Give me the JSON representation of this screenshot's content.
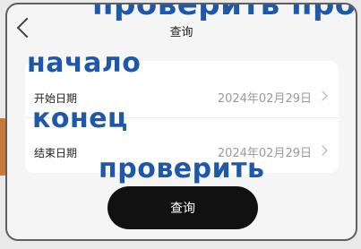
{
  "overlay": {
    "top_text": "проверить проверить",
    "start_label": "начало",
    "end_label": "конец",
    "check_label": "проверить"
  },
  "nav": {
    "title": "查询",
    "back_icon": "chevron-left-icon"
  },
  "form": {
    "rows": [
      {
        "label": "开始日期",
        "value": "2024年02月29日"
      },
      {
        "label": "结束日期",
        "value": "2024年02月29日"
      }
    ]
  },
  "actions": {
    "query_label": "查询"
  },
  "colors": {
    "overlay_text": "#1f58a8",
    "button_bg": "#111111",
    "value_text": "#9a9a9a"
  }
}
